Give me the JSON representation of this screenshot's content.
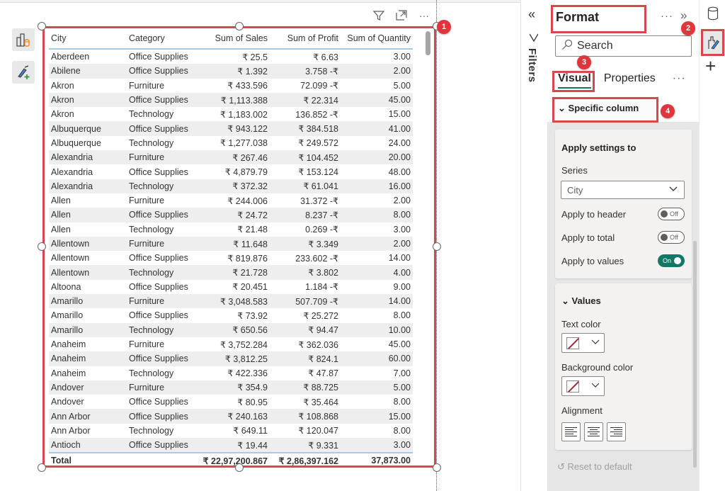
{
  "visual_header": {
    "filter_icon": "filter-icon",
    "focus_icon": "focus-mode-icon",
    "more_icon": "more-options-icon",
    "more_label": "···"
  },
  "left_tools": [
    {
      "icon": "build-visual-icon"
    },
    {
      "icon": "format-painter-add-icon"
    }
  ],
  "table": {
    "columns": [
      "City",
      "Category",
      "Sum of Sales",
      "Sum of Profit",
      "Sum of Quantity"
    ],
    "rows": [
      [
        "Aberdeen",
        "Office Supplies",
        "₹ 25.5",
        "₹ 6.63",
        "3.00"
      ],
      [
        "Abilene",
        "Office Supplies",
        "₹ 1.392",
        "3.758 -₹",
        "2.00"
      ],
      [
        "Akron",
        "Furniture",
        "₹ 433.596",
        "72.099 -₹",
        "5.00"
      ],
      [
        "Akron",
        "Office Supplies",
        "₹ 1,113.388",
        "₹ 22.314",
        "45.00"
      ],
      [
        "Akron",
        "Technology",
        "₹ 1,183.002",
        "136.852 -₹",
        "15.00"
      ],
      [
        "Albuquerque",
        "Office Supplies",
        "₹ 943.122",
        "₹ 384.518",
        "41.00"
      ],
      [
        "Albuquerque",
        "Technology",
        "₹ 1,277.038",
        "₹ 249.572",
        "24.00"
      ],
      [
        "Alexandria",
        "Furniture",
        "₹ 267.46",
        "₹ 104.452",
        "20.00"
      ],
      [
        "Alexandria",
        "Office Supplies",
        "₹ 4,879.79",
        "₹ 153.124",
        "48.00"
      ],
      [
        "Alexandria",
        "Technology",
        "₹ 372.32",
        "₹ 61.041",
        "16.00"
      ],
      [
        "Allen",
        "Furniture",
        "₹ 244.006",
        "31.372 -₹",
        "2.00"
      ],
      [
        "Allen",
        "Office Supplies",
        "₹ 24.72",
        "8.237 -₹",
        "8.00"
      ],
      [
        "Allen",
        "Technology",
        "₹ 21.48",
        "0.269 -₹",
        "3.00"
      ],
      [
        "Allentown",
        "Furniture",
        "₹ 11.648",
        "₹ 3.349",
        "2.00"
      ],
      [
        "Allentown",
        "Office Supplies",
        "₹ 819.876",
        "233.602 -₹",
        "14.00"
      ],
      [
        "Allentown",
        "Technology",
        "₹ 21.728",
        "₹ 3.802",
        "4.00"
      ],
      [
        "Altoona",
        "Office Supplies",
        "₹ 20.451",
        "1.184 -₹",
        "9.00"
      ],
      [
        "Amarillo",
        "Furniture",
        "₹ 3,048.583",
        "507.709 -₹",
        "14.00"
      ],
      [
        "Amarillo",
        "Office Supplies",
        "₹ 73.92",
        "₹ 25.272",
        "8.00"
      ],
      [
        "Amarillo",
        "Technology",
        "₹ 650.56",
        "₹ 94.47",
        "10.00"
      ],
      [
        "Anaheim",
        "Furniture",
        "₹ 3,752.284",
        "₹ 362.036",
        "45.00"
      ],
      [
        "Anaheim",
        "Office Supplies",
        "₹ 3,812.25",
        "₹ 824.1",
        "60.00"
      ],
      [
        "Anaheim",
        "Technology",
        "₹ 422.336",
        "₹ 47.87",
        "7.00"
      ],
      [
        "Andover",
        "Furniture",
        "₹ 354.9",
        "₹ 88.725",
        "5.00"
      ],
      [
        "Andover",
        "Office Supplies",
        "₹ 80.95",
        "₹ 35.464",
        "8.00"
      ],
      [
        "Ann Arbor",
        "Office Supplies",
        "₹ 240.163",
        "₹ 108.868",
        "15.00"
      ],
      [
        "Ann Arbor",
        "Technology",
        "₹ 649.11",
        "₹ 120.047",
        "8.00"
      ],
      [
        "Antioch",
        "Office Supplies",
        "₹ 19.44",
        "₹ 9.331",
        "3.00"
      ]
    ],
    "total": [
      "Total",
      "",
      "₹ 22,97,200.867",
      "₹ 2,86,397.162",
      "37,873.00"
    ]
  },
  "badges": [
    "1",
    "2",
    "3",
    "4"
  ],
  "filters": {
    "collapse_label": "«",
    "label": "Filters"
  },
  "format_pane": {
    "title": "Format",
    "more_label": "···",
    "expand_label": "»",
    "search_placeholder": "Search",
    "tabs": [
      "Visual",
      "Properties"
    ],
    "tabs_more": "···",
    "section": "Specific column",
    "apply_card": {
      "title": "Apply settings to",
      "series_label": "Series",
      "series_value": "City",
      "toggles": [
        {
          "label": "Apply to header",
          "state": "Off"
        },
        {
          "label": "Apply to total",
          "state": "Off"
        },
        {
          "label": "Apply to values",
          "state": "On"
        }
      ]
    },
    "values_card": {
      "title": "Values",
      "text_color_label": "Text color",
      "background_color_label": "Background color",
      "alignment_label": "Alignment",
      "alignment_options": [
        "left",
        "center",
        "right"
      ]
    },
    "reset_label": "Reset to default"
  },
  "colors": {
    "highlight_red": "#d9464b",
    "toggle_on": "#117865",
    "header_rule": "#a8cbe9"
  }
}
